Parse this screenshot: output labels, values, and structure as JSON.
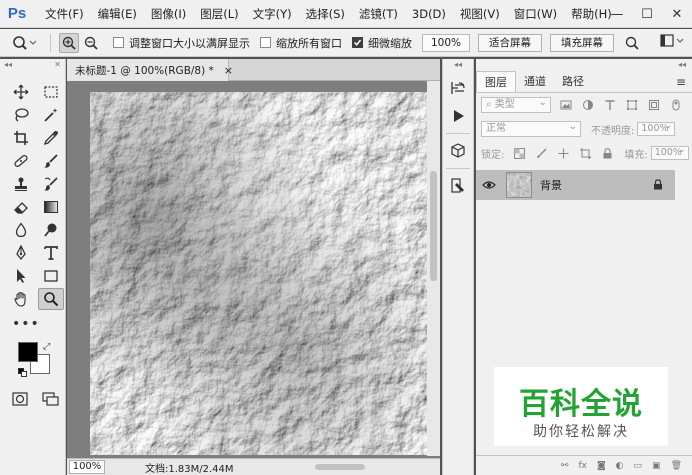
{
  "app": {
    "logo": "Ps"
  },
  "menu": [
    "文件(F)",
    "编辑(E)",
    "图像(I)",
    "图层(L)",
    "文字(Y)",
    "选择(S)",
    "滤镜(T)",
    "3D(D)",
    "视图(V)",
    "窗口(W)",
    "帮助(H)"
  ],
  "window_controls": {
    "minimize": "—",
    "maximize": "☐",
    "close": "✕"
  },
  "options": {
    "resize_windows_label": "调整窗口大小以满屏显示",
    "resize_windows_checked": false,
    "zoom_all_label": "缩放所有窗口",
    "zoom_all_checked": false,
    "scrubby_zoom_label": "细微缩放",
    "scrubby_zoom_checked": true,
    "zoom_value": "100%",
    "fit_screen_label": "适合屏幕",
    "fill_screen_label": "填充屏幕"
  },
  "document": {
    "tab_title": "未标题-1 @ 100%(RGB/8) *",
    "tab_close": "×",
    "zoom": "100%",
    "info": "文档:1.83M/2.44M"
  },
  "layers_panel": {
    "tabs": [
      "图层",
      "通道",
      "路径"
    ],
    "active_tab": "图层",
    "filter_type": "类型",
    "blend_mode": "正常",
    "opacity_label": "不透明度:",
    "opacity_value": "100%",
    "lock_label": "锁定:",
    "fill_label": "填充:",
    "fill_value": "100%",
    "layer_name": "背景",
    "footer_icons": [
      "link-icon",
      "fx-icon",
      "mask-icon",
      "adjustment-icon",
      "group-icon",
      "new-layer-icon",
      "delete-icon"
    ],
    "fx_label": "fx"
  },
  "watermark": {
    "title": "百科全说",
    "subtitle": "助你轻松解决",
    "color": "#23a334"
  },
  "colors": {
    "foreground": "#000000",
    "background": "#ffffff"
  }
}
